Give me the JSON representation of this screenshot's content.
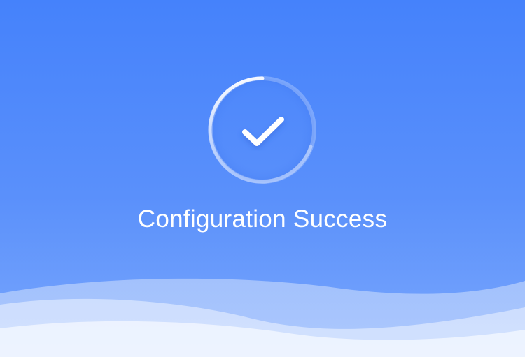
{
  "screen": {
    "title": "Configuration Success",
    "status": "success"
  },
  "icons": {
    "status": "check-circle-icon"
  },
  "colors": {
    "background_top": "#4582fb",
    "background_bottom": "#7aa7fc",
    "text": "#ffffff",
    "wave": "#ffffff"
  }
}
